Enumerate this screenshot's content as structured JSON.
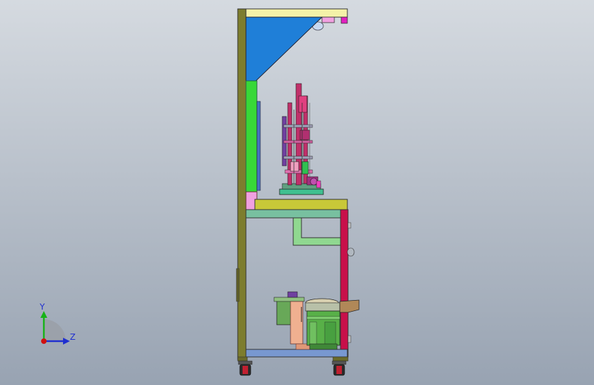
{
  "viewport": {
    "background_top": "#d5dae0",
    "background_bottom": "#98a3b2"
  },
  "triad": {
    "y_label": "Y",
    "z_label": "Z",
    "colors": {
      "y": "#17b317",
      "z": "#1f2fd0",
      "origin": "#d01010",
      "quadrant": "#9aa0a8"
    }
  },
  "colors": {
    "frame_olive": "#7d7d2e",
    "top_beam": "#f4f2a8",
    "gusset_blue": "#1f7fd8",
    "green_panel": "#38d838",
    "pink_panel": "#f0a0e0",
    "table_yellow": "#c8c838",
    "teal_rail": "#78c0a0",
    "bracket_green": "#90d890",
    "red_post": "#c8104a",
    "base_blue": "#7898d0",
    "feeder_green": "#58b048",
    "salmon": "#f0b090",
    "mechanism_magenta": "#c0306a",
    "mechanism_purple": "#7040a0",
    "wheel_dark": "#2a2a2a",
    "wheel_red": "#c02030"
  }
}
